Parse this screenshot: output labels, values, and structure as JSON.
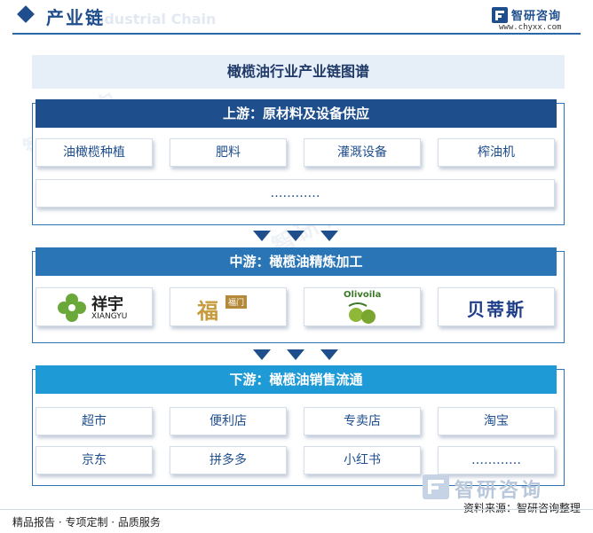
{
  "header": {
    "title": "产业链",
    "ghost": "Industrial Chain",
    "brand_name": "智研咨询",
    "brand_url": "www.chyxx.com"
  },
  "banner": {
    "title": "橄榄油行业产业链图谱"
  },
  "upstream": {
    "title": "上游：原材料及设备供应",
    "items": [
      "油橄榄种植",
      "肥料",
      "灌溉设备",
      "榨油机"
    ],
    "more": "…………"
  },
  "midstream": {
    "title": "中游：橄榄油精炼加工",
    "logos": [
      {
        "icon": "xiangyu-logo",
        "text_cn": "祥宇",
        "text_en": "XIANGYU"
      },
      {
        "icon": "fu-logo",
        "text_cn": "福",
        "text_sub": "福门"
      },
      {
        "icon": "olivoila-logo",
        "text_en": "Olivoila"
      },
      {
        "icon": "betis-logo",
        "text_cn": "贝蒂斯"
      }
    ]
  },
  "downstream": {
    "title": "下游：橄榄油销售流通",
    "items": [
      "超市",
      "便利店",
      "专卖店",
      "淘宝",
      "京东",
      "拼多多",
      "小红书",
      "…………"
    ]
  },
  "footer": {
    "left": "精品报告 · 专项定制 · 品质服务",
    "watermark": "智研咨询",
    "source": "资料来源：智研咨询整理"
  },
  "colors": {
    "upstream_head": "#1f4e8c",
    "midstream_head": "#2a75b6",
    "downstream_head": "#1e9ad6",
    "arrow": "#1f4e8c"
  }
}
